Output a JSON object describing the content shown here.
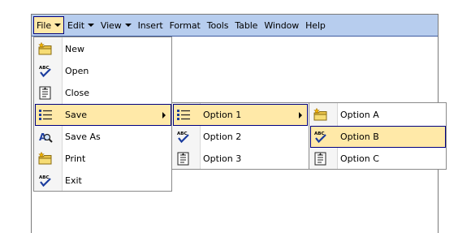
{
  "menubar": {
    "items": [
      {
        "label": "File",
        "has_caret": true,
        "active": true
      },
      {
        "label": "Edit",
        "has_caret": true
      },
      {
        "label": "View",
        "has_caret": true
      },
      {
        "label": "Insert"
      },
      {
        "label": "Format"
      },
      {
        "label": "Tools"
      },
      {
        "label": "Table"
      },
      {
        "label": "Window"
      },
      {
        "label": "Help"
      }
    ]
  },
  "file_menu": {
    "items": [
      {
        "label": "New",
        "icon": "new-folder-icon"
      },
      {
        "label": "Open",
        "icon": "spellcheck-icon"
      },
      {
        "label": "Close",
        "icon": "document-icon"
      },
      {
        "label": "Save",
        "icon": "list-icon",
        "submenu": true,
        "highlighted": true
      },
      {
        "label": "Save As",
        "icon": "find-icon"
      },
      {
        "label": "Print",
        "icon": "new-folder-icon"
      },
      {
        "label": "Exit",
        "icon": "spellcheck-icon"
      }
    ]
  },
  "save_submenu": {
    "items": [
      {
        "label": "Option 1",
        "icon": "list-icon",
        "submenu": true,
        "highlighted": true
      },
      {
        "label": "Option 2",
        "icon": "spellcheck-icon"
      },
      {
        "label": "Option 3",
        "icon": "document-icon"
      }
    ]
  },
  "option1_submenu": {
    "items": [
      {
        "label": "Option A",
        "icon": "new-folder-icon"
      },
      {
        "label": "Option B",
        "icon": "spellcheck-icon",
        "highlighted": true
      },
      {
        "label": "Option C",
        "icon": "document-icon"
      }
    ]
  },
  "colors": {
    "menubar_bg": "#b7cdee",
    "highlight_bg": "#ffe9a8",
    "highlight_border": "#000080"
  }
}
